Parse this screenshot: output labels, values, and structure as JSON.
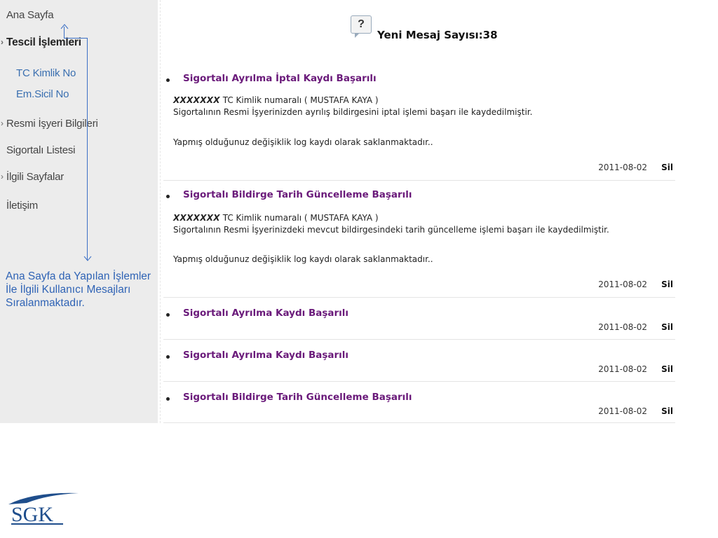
{
  "sidebar": {
    "items": [
      {
        "label": "Ana Sayfa"
      },
      {
        "label": "Tescil İşlemleri"
      },
      {
        "label": "TC Kimlik No"
      },
      {
        "label": "Em.Sicil No"
      },
      {
        "label": "Resmi İşyeri Bilgileri"
      },
      {
        "label": "Sigortalı Listesi"
      },
      {
        "label": "İlgili Sayfalar"
      },
      {
        "label": "İletişim"
      }
    ]
  },
  "annotation": {
    "lines": [
      "Ana Sayfa da Yapılan İşlemler",
      "İle İlgili Kullanıcı Mesajları",
      "Sıralanmaktadır."
    ]
  },
  "header": {
    "icon_glyph": "?",
    "message_count_label": "Yeni Mesaj Sayısı:38"
  },
  "messages": [
    {
      "title": "Sigortalı Ayrılma İptal Kaydı Başarılı",
      "masked_id": "XXXXXXX",
      "line1_rest": " TC Kimlik numaralı ( MUSTAFA KAYA )",
      "line2": "Sigortalının Resmi İşyerinizden ayrılış bildirgesini iptal işlemi başarı ile kaydedilmiştir.",
      "line3": "Yapmış olduğunuz değişiklik log kaydı olarak saklanmaktadır..",
      "date": "2011-08-02",
      "delete_label": "Sil"
    },
    {
      "title": "Sigortalı Bildirge Tarih Güncelleme Başarılı",
      "masked_id": "XXXXXXX",
      "line1_rest": " TC Kimlik numaralı ( MUSTAFA KAYA )",
      "line2": "Sigortalının Resmi İşyerinizdeki mevcut bildirgesindeki tarih güncelleme işlemi başarı ile kaydedilmiştir.",
      "line3": "Yapmış olduğunuz değişiklik log kaydı olarak saklanmaktadır..",
      "date": "2011-08-02",
      "delete_label": "Sil"
    },
    {
      "title": "Sigortalı Ayrılma Kaydı Başarılı",
      "date": "2011-08-02",
      "delete_label": "Sil"
    },
    {
      "title": "Sigortalı Ayrılma Kaydı Başarılı",
      "date": "2011-08-02",
      "delete_label": "Sil"
    },
    {
      "title": "Sigortalı Bildirge Tarih Güncelleme Başarılı",
      "date": "2011-08-02",
      "delete_label": "Sil"
    }
  ],
  "logo": {
    "text": "SGK",
    "accent_color": "#1f4e8c"
  }
}
